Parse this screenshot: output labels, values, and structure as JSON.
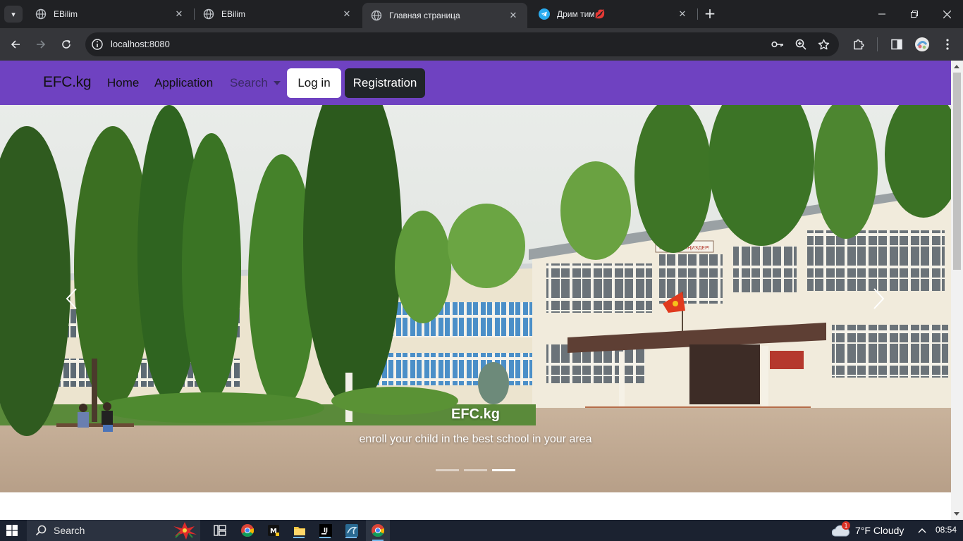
{
  "browser": {
    "tabs": [
      {
        "title": "EBilim",
        "favicon": "globe-icon",
        "active": false
      },
      {
        "title": "EBilim",
        "favicon": "globe-icon",
        "active": false
      },
      {
        "title": "Главная страница",
        "favicon": "globe-icon",
        "active": true
      },
      {
        "title": "Дрим тим💋",
        "favicon": "telegram-icon",
        "active": false
      }
    ],
    "address": "localhost:8080"
  },
  "site": {
    "brand": "EFC.kg",
    "nav": {
      "home": "Home",
      "application": "Application",
      "search": "Search",
      "login": "Log in",
      "registration": "Registration"
    },
    "carousel": {
      "caption_title": "EFC.kg",
      "caption_text": "enroll your child in the best school in your area",
      "slide_count": 3,
      "active_slide": 3,
      "sign_text": "КОШ КЕЛИҢИЗДЕР!"
    },
    "colors": {
      "nav_bg": "#6f42c1",
      "login_bg": "#ffffff",
      "registration_bg": "#212529"
    }
  },
  "taskbar": {
    "search": "Search",
    "weather": "7°F  Cloudy",
    "weather_badge": "1",
    "time": "08:54"
  }
}
